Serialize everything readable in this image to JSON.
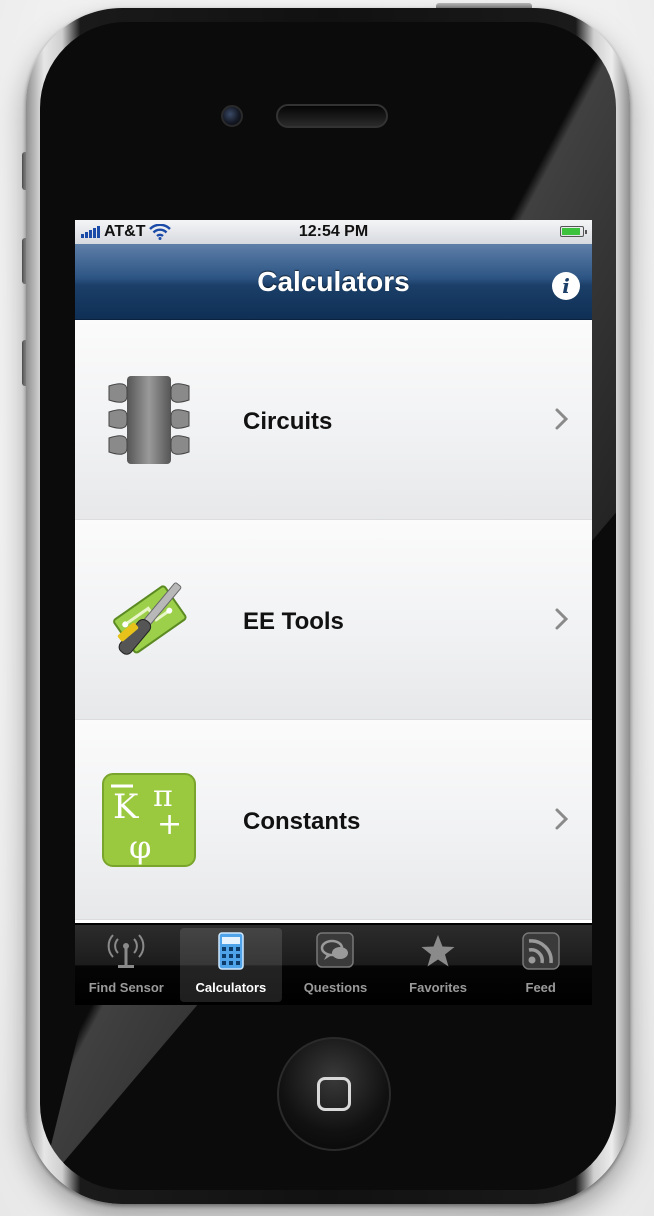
{
  "status_bar": {
    "carrier": "AT&T",
    "time": "12:54 PM",
    "icons": [
      "signal-bars-icon",
      "wifi-icon",
      "battery-icon"
    ]
  },
  "nav_bar": {
    "title": "Calculators",
    "info_icon": "info-icon"
  },
  "list": {
    "items": [
      {
        "label": "Circuits",
        "icon": "chip-icon"
      },
      {
        "label": "EE Tools",
        "icon": "tools-icon"
      },
      {
        "label": "Constants",
        "icon": "constants-icon"
      }
    ]
  },
  "tab_bar": {
    "selected": "Calculators",
    "tabs": [
      {
        "label": "Find Sensor",
        "icon": "antenna-icon"
      },
      {
        "label": "Calculators",
        "icon": "calculator-icon"
      },
      {
        "label": "Questions",
        "icon": "speech-bubbles-icon"
      },
      {
        "label": "Favorites",
        "icon": "star-icon"
      },
      {
        "label": "Feed",
        "icon": "rss-icon"
      }
    ]
  },
  "colors": {
    "nav_bar_top": "#5e7fa8",
    "nav_bar_bottom": "#0f2f55",
    "constants_icon_bg": "#9ac940",
    "battery_fill": "#3cc23c"
  }
}
